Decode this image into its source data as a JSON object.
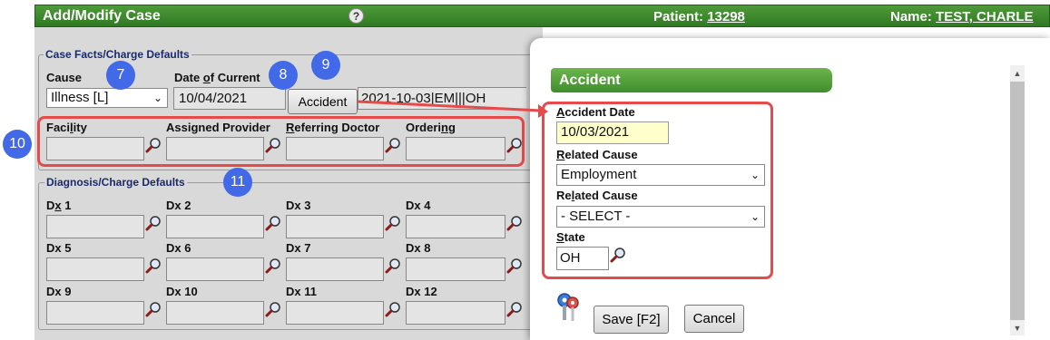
{
  "header": {
    "title": "Add/Modify Case",
    "help": "?",
    "patient_label": "Patient:",
    "patient_id": "13298",
    "name_label": "Name:",
    "name_value": "TEST, CHARLE"
  },
  "case_facts": {
    "legend": "Case Facts/Charge Defaults",
    "cause_label": "Cause",
    "cause_value": "Illness [L]",
    "date_label_pre": "Date ",
    "date_label_u": "o",
    "date_label_post": "f Current",
    "date_value": "10/04/2021",
    "accident_button": "Accident",
    "accident_summary": "2021-10-03|EM|||OH",
    "facility_label_pre": "Faci",
    "facility_label_u": "l",
    "facility_label_post": "ity",
    "assigned_provider_label": "Assigned Provider",
    "referring_label_u": "R",
    "referring_label_post": "eferring Doctor",
    "ordering_label_pre": "Orderi",
    "ordering_label_u": "n",
    "ordering_label_post": "g"
  },
  "diagnosis": {
    "legend": "Diagnosis/Charge Defaults",
    "dx1_pre": "D",
    "dx1_u": "x",
    "dx1_post": " 1",
    "dx2": "Dx 2",
    "dx3": "Dx 3",
    "dx4": "Dx 4",
    "dx5": "Dx 5",
    "dx6": "Dx 6",
    "dx7": "Dx 7",
    "dx8": "Dx 8",
    "dx9": "Dx 9",
    "dx10": "Dx 10",
    "dx11": "Dx 11",
    "dx12": "Dx 12"
  },
  "callouts": {
    "c7": "7",
    "c8": "8",
    "c9": "9",
    "c10": "10",
    "c11": "11"
  },
  "accident_panel": {
    "title": "Accident",
    "date_label_u": "A",
    "date_label_post": "ccident Date",
    "date_value": "10/03/2021",
    "related1_label_u": "R",
    "related1_label_post": "elated Cause",
    "related1_value": "Employment",
    "related2_label_pre": "Re",
    "related2_label_u": "l",
    "related2_label_post": "ated Cause",
    "related2_value": "- SELECT -",
    "state_label_u": "S",
    "state_label_post": "tate",
    "state_value": "OH",
    "save_button": "Save [F2]",
    "cancel_button": "Cancel"
  },
  "colors": {
    "header_green": "#2f7a22",
    "callout_blue": "#4169e8",
    "highlight_red": "#e64b4b",
    "date_field_yellow": "#ffffcc"
  },
  "icons": [
    "help-icon",
    "magnifier-icon",
    "chevron-down-icon",
    "keys-icon",
    "scroll-up-icon",
    "scroll-down-icon"
  ]
}
